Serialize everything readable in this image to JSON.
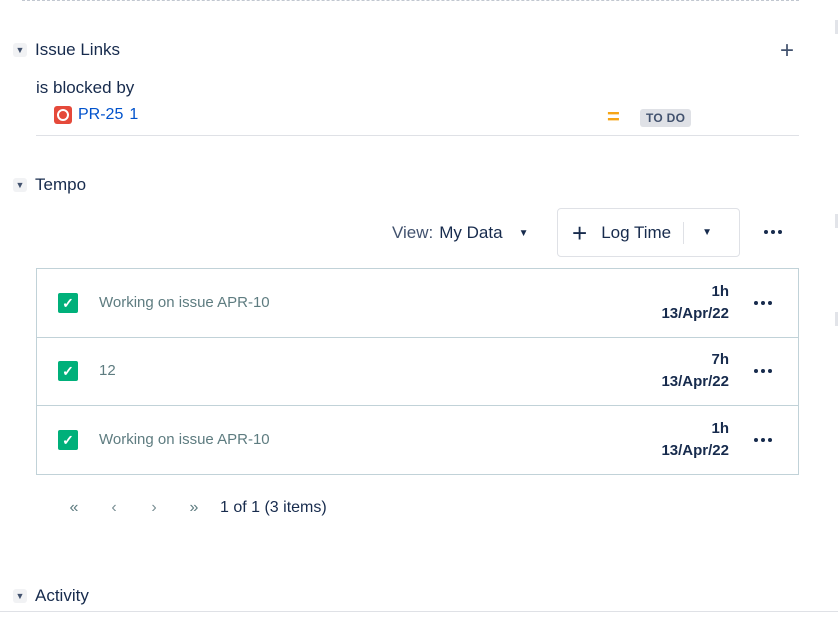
{
  "issue_links": {
    "title": "Issue Links",
    "add_icon": "plus-icon",
    "relation_label": "is blocked by",
    "linked_issue": {
      "key": "PR-25",
      "summary": "1",
      "priority_icon": "priority-medium-icon",
      "priority_symbol": "=",
      "status": "TO DO"
    }
  },
  "tempo": {
    "title": "Tempo",
    "view_label": "View:",
    "view_value": "My Data",
    "log_time_label": "Log Time",
    "worklogs": [
      {
        "description": "Working on issue APR-10",
        "duration": "1h",
        "date": "13/Apr/22"
      },
      {
        "description": "12",
        "duration": "7h",
        "date": "13/Apr/22"
      },
      {
        "description": "Working on issue APR-10",
        "duration": "1h",
        "date": "13/Apr/22"
      }
    ],
    "pagination": {
      "first": "«",
      "prev": "‹",
      "next": "›",
      "last": "»",
      "info": "1 of 1 (3 items)"
    }
  },
  "activity": {
    "title": "Activity"
  },
  "colors": {
    "link": "#0052cc",
    "check": "#00b07a",
    "priority": "#f6a516",
    "lozenge_bg": "#dfe1e6",
    "issue_type": "#e5493a"
  }
}
